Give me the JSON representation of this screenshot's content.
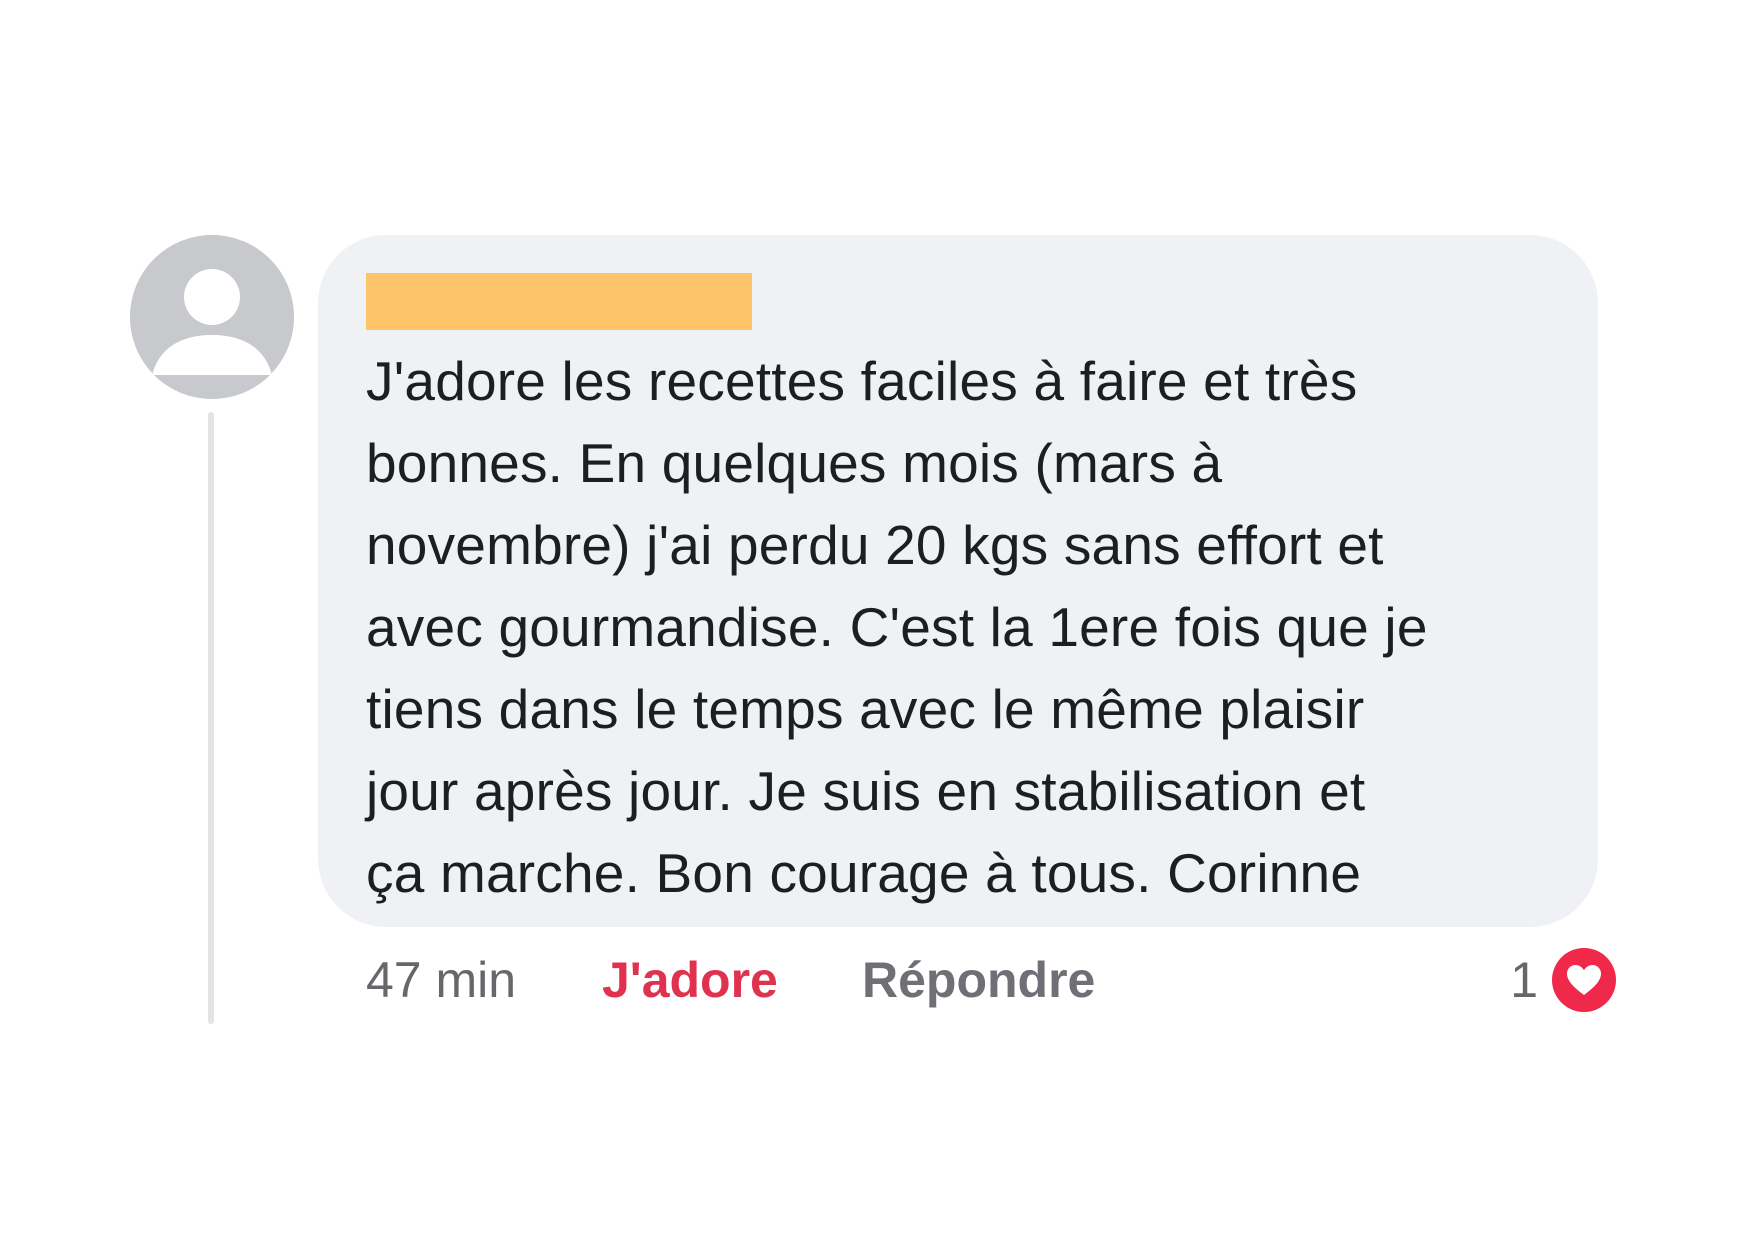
{
  "comment": {
    "avatar_icon": "default-user-avatar-icon",
    "author_name_redacted": "",
    "text_lines": [
      "J'adore les recettes faciles à faire et très",
      "bonnes. En quelques mois (mars à",
      "novembre) j'ai perdu 20 kgs sans effort et",
      "avec gourmandise. C'est la 1ere fois que je",
      "tiens dans le temps avec le même plaisir",
      "jour après jour. Je suis en stabilisation et",
      "ça marche. Bon courage à tous. Corinne"
    ],
    "actions": {
      "timestamp": "47 min",
      "like_label": "J'adore",
      "reply_label": "Répondre"
    },
    "reactions": {
      "count": "1",
      "icon": "heart-icon",
      "color": "#f02849"
    }
  },
  "colors": {
    "bubble_background": "#f0f1f4",
    "redaction_bar": "#fdc469",
    "like_active": "#e0314e"
  }
}
